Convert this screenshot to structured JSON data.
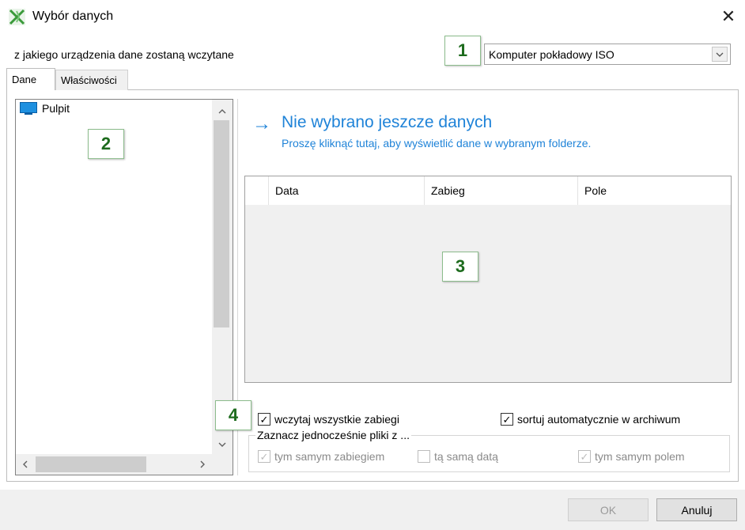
{
  "window": {
    "title": "Wybór danych",
    "close_glyph": "✕",
    "icon": "app-logo-icon"
  },
  "device": {
    "label": "z jakiego urządzenia dane zostaną wczytane",
    "selected": "Komputer pokładowy ISO",
    "dropdown_icon": "chevron-down-icon"
  },
  "tabs": [
    {
      "label": "Dane",
      "active": true
    },
    {
      "label": "Właściwości",
      "active": false
    }
  ],
  "tree": {
    "items": [
      {
        "label": "Pulpit",
        "icon": "desktop-icon"
      }
    ]
  },
  "no_data": {
    "arrow": "→",
    "title": "Nie wybrano jeszcze danych",
    "subtitle": "Proszę kliknąć tutaj, aby wyświetlić dane w wybranym folderze."
  },
  "table": {
    "columns": [
      "",
      "Data",
      "Zabieg",
      "Pole"
    ],
    "rows": []
  },
  "options": {
    "load_all": {
      "label": "wczytaj wszystkie zabiegi",
      "checked": true
    },
    "auto_sort": {
      "label": "sortuj automatycznie w archiwum",
      "checked": true
    },
    "group_title": "Zaznacz jednocześnie pliki z ...",
    "same_treatment": {
      "label": "tym samym zabiegiem",
      "checked": true,
      "enabled": false
    },
    "same_date": {
      "label": "tą samą datą",
      "checked": false,
      "enabled": false
    },
    "same_field": {
      "label": "tym samym polem",
      "checked": true,
      "enabled": false
    }
  },
  "badges": [
    "1",
    "2",
    "3",
    "4"
  ],
  "buttons": {
    "ok": "OK",
    "cancel": "Anuluj"
  },
  "colors": {
    "accent": "#1f83d8",
    "badge_text": "#1d6b1d"
  }
}
